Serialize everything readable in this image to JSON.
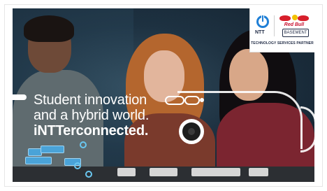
{
  "banner": {
    "headline_line1": "Student innovation",
    "headline_line2": "and a hybrid world.",
    "headline_line3": "iNTTerconnected."
  },
  "logos": {
    "ntt_label": "NTT",
    "redbull_label": "Red Bull",
    "basement_label": "BASEMENT",
    "partner_label": "TECHNOLOGY SERVICES PARTNER"
  },
  "colors": {
    "ntt_blue": "#1f7fd6",
    "redbull_red": "#d71f2b",
    "headline_white": "#ffffff"
  }
}
